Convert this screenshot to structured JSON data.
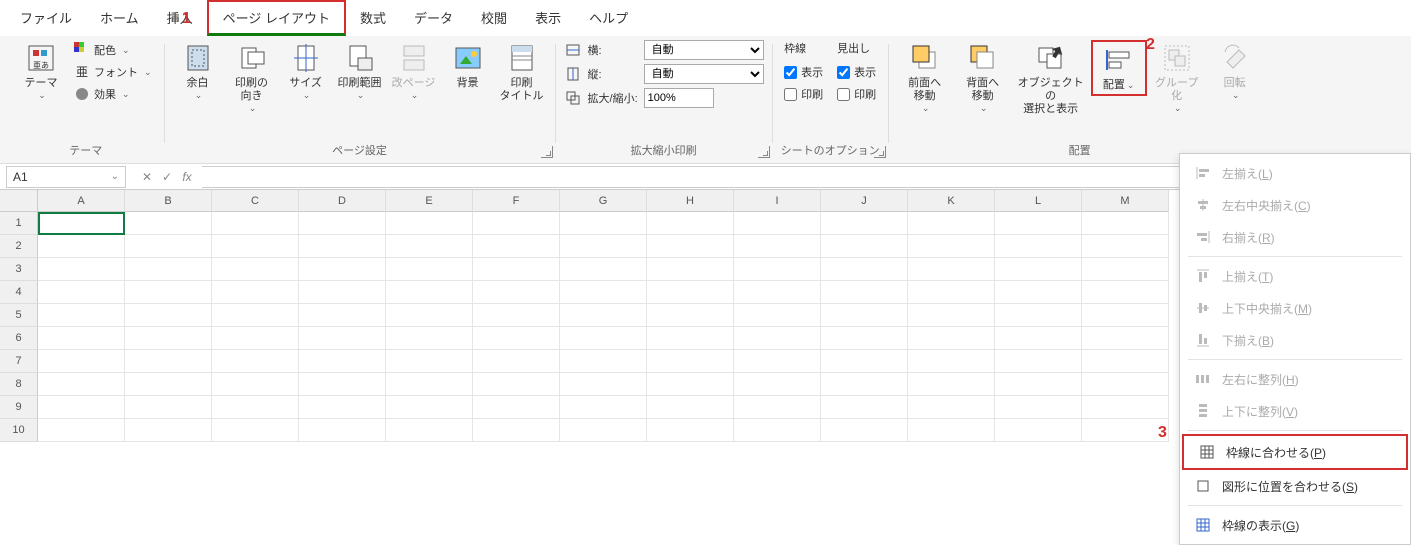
{
  "tabs": [
    "ファイル",
    "ホーム",
    "挿入",
    "ページ レイアウト",
    "数式",
    "データ",
    "校閲",
    "表示",
    "ヘルプ"
  ],
  "active_tab": 3,
  "annotations": {
    "a1": "1",
    "a2": "2",
    "a3": "3"
  },
  "theme_group": {
    "theme": "テーマ",
    "colors": "配色",
    "fonts": "フォント",
    "effects": "効果",
    "label": "テーマ"
  },
  "page_setup": {
    "margins": "余白",
    "orientation": "印刷の\n向き",
    "size": "サイズ",
    "area": "印刷範囲",
    "breaks": "改ページ",
    "bg": "背景",
    "titles": "印刷\nタイトル",
    "label": "ページ設定"
  },
  "scale": {
    "width_lbl": "横:",
    "height_lbl": "縦:",
    "scale_lbl": "拡大/縮小:",
    "auto": "自動",
    "val": "100%",
    "label": "拡大縮小印刷"
  },
  "sheet_opts": {
    "grid": "枠線",
    "head": "見出し",
    "view": "表示",
    "print": "印刷",
    "label": "シートのオプション",
    "grid_view": true,
    "grid_print": false,
    "head_view": true,
    "head_print": false
  },
  "arrange": {
    "front": "前面へ\n移動",
    "back": "背面へ\n移動",
    "selpane": "オブジェクトの\n選択と表示",
    "align": "配置",
    "group": "グループ化",
    "rotate": "回転",
    "label": "配置"
  },
  "menu": {
    "left": "左揃え(L)",
    "hcenter": "左右中央揃え(C)",
    "right": "右揃え(R)",
    "top": "上揃え(T)",
    "vcenter": "上下中央揃え(M)",
    "bottom": "下揃え(B)",
    "disth": "左右に整列(H)",
    "distv": "上下に整列(V)",
    "snap_grid": "枠線に合わせる(P)",
    "snap_shape": "図形に位置を合わせる(S)",
    "show_grid": "枠線の表示(G)"
  },
  "namebox": "A1",
  "columns": [
    "A",
    "B",
    "C",
    "D",
    "E",
    "F",
    "G",
    "H",
    "I",
    "J",
    "K",
    "L",
    "M"
  ],
  "rows": [
    1,
    2,
    3,
    4,
    5,
    6,
    7,
    8,
    9,
    10
  ]
}
